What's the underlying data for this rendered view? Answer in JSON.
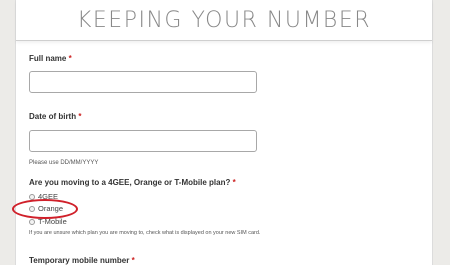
{
  "header": {
    "title": "KEEPING YOUR NUMBER"
  },
  "form": {
    "full_name": {
      "label": "Full name",
      "required_mark": "*",
      "value": ""
    },
    "dob": {
      "label": "Date of birth",
      "required_mark": "*",
      "value": "",
      "help": "Please use DD/MM/YYYY"
    },
    "plan_question": {
      "label": "Are you moving to a 4GEE, Orange or T-Mobile plan?",
      "required_mark": "*",
      "options": [
        "4GEE",
        "Orange",
        "T-Mobile"
      ],
      "highlighted_option": "Orange",
      "help": "If you are unsure which plan you are moving to, check what is displayed on your new SIM card."
    },
    "temp_number": {
      "label": "Temporary mobile number",
      "required_mark": "*"
    }
  },
  "colors": {
    "background": "#ecebe8",
    "required": "#cc2222",
    "highlight": "#d0202a"
  }
}
